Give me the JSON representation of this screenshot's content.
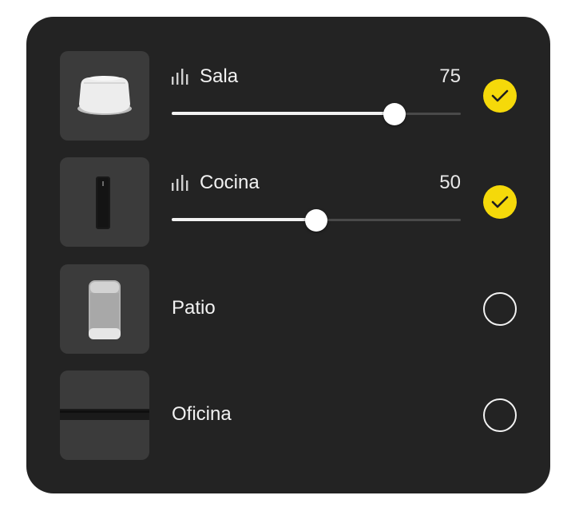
{
  "colors": {
    "panel": "#232323",
    "thumb_bg": "#3b3b3b",
    "accent_yellow": "#f5d90a",
    "text": "#f2f2f2",
    "track": "#4a4a4a"
  },
  "rooms": [
    {
      "name": "Sala",
      "volume": "75",
      "volume_fraction": 0.77,
      "selected": true,
      "icon": "speaker-bars-icon",
      "device_icon": "ceiling-speaker-icon"
    },
    {
      "name": "Cocina",
      "volume": "50",
      "volume_fraction": 0.5,
      "selected": true,
      "icon": "speaker-bars-icon",
      "device_icon": "portable-speaker-icon"
    },
    {
      "name": "Patio",
      "selected": false,
      "device_icon": "outdoor-speaker-icon"
    },
    {
      "name": "Oficina",
      "selected": false,
      "device_icon": "soundbar-icon"
    }
  ]
}
